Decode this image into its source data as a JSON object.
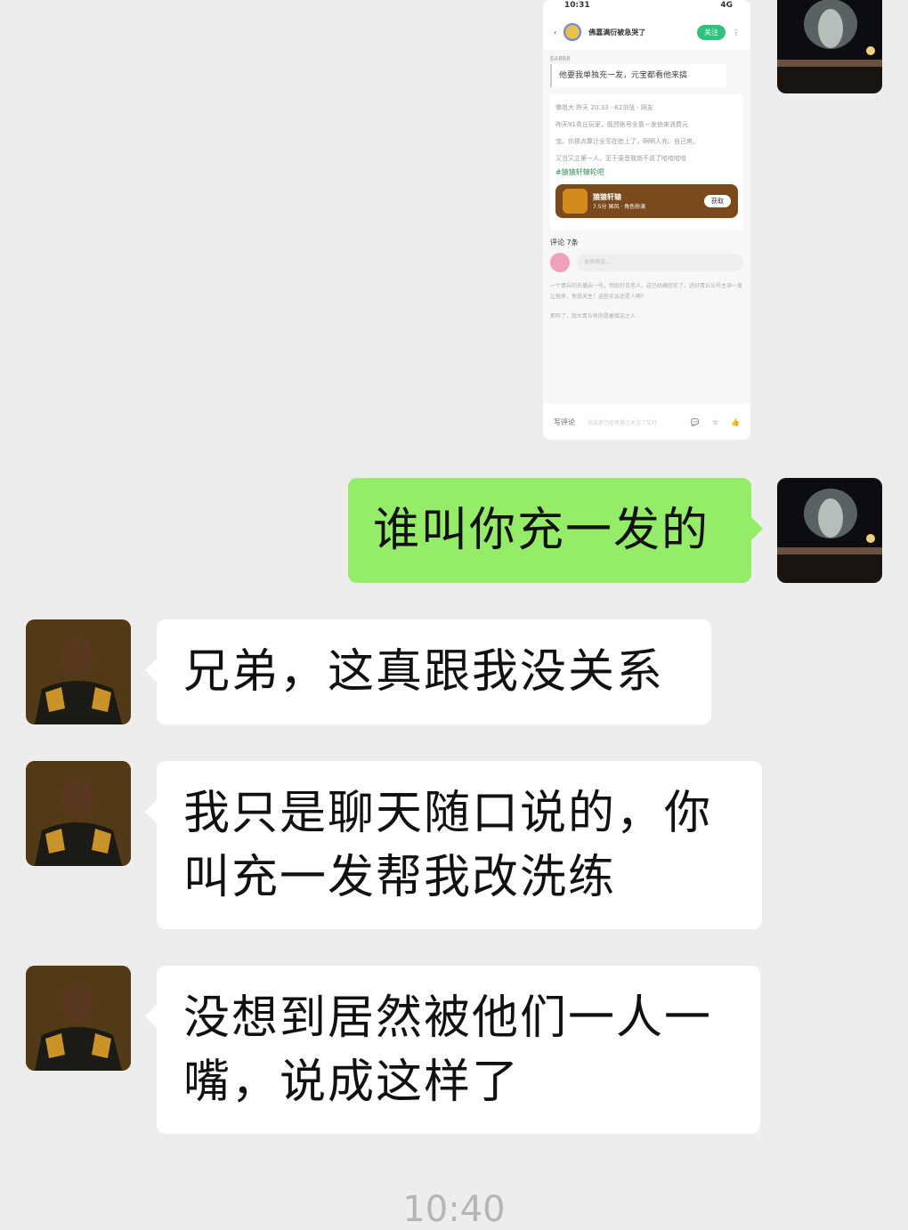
{
  "messages": [
    {
      "type": "image",
      "side": "out"
    },
    {
      "type": "text",
      "side": "out",
      "lines": [
        "谁叫你充一发的"
      ]
    },
    {
      "type": "text",
      "side": "in",
      "lines": [
        "兄弟，这真跟我没关系"
      ]
    },
    {
      "type": "text",
      "side": "in",
      "lines": [
        "我只是聊天随口说的，你",
        "叫充一发帮我改洗练"
      ]
    },
    {
      "type": "text",
      "side": "in",
      "lines": [
        "没想到居然被他们一人一",
        "嘴，说成这样了"
      ]
    }
  ],
  "timestamp": "10:40",
  "screenshot": {
    "status_time": "10:31",
    "status_icons": "4G",
    "author": "佛嘉满衍被急哭了",
    "follow_label": "关注",
    "quote_label": "EA888",
    "quote_text": "他要我单独充一发，元宝都看他来搞",
    "post_meta": "佛祖大 昨天 20:33 · 62浏览 · 网友",
    "post_lines": [
      "昨天91青丘玩家，既然账号全靠一发他来消费元",
      "宝。你那点算计全写在脸上了，啊啊人充、自己爽。",
      "又当又立第一人，至于录音我就不说了哈哈哈哈"
    ],
    "post_tag": "#猿猿轩辕轮吧",
    "game_name": "猿猿轩辕",
    "game_sub": "7.5分 国风 · 角色扮演",
    "game_button": "获取",
    "comments_title": "评论 7条",
    "comment_placeholder": "发表观点...",
    "comment1": "一个青丘的去播出一号，然后打白老人，这已经确信实了。还好青丘公号主冲一发让他来，他说天生！这些买云还是人啊?",
    "comment2": "那咋了，我大青丘有的是敢做这之人",
    "bottom_label": "写评论",
    "bottom_hint": "我这条已经有做过关注了又打"
  },
  "colors": {
    "background": "#ededed",
    "incoming_bubble": "#ffffff",
    "outgoing_bubble": "#95ec69",
    "timestamp": "#b5b5b5"
  }
}
